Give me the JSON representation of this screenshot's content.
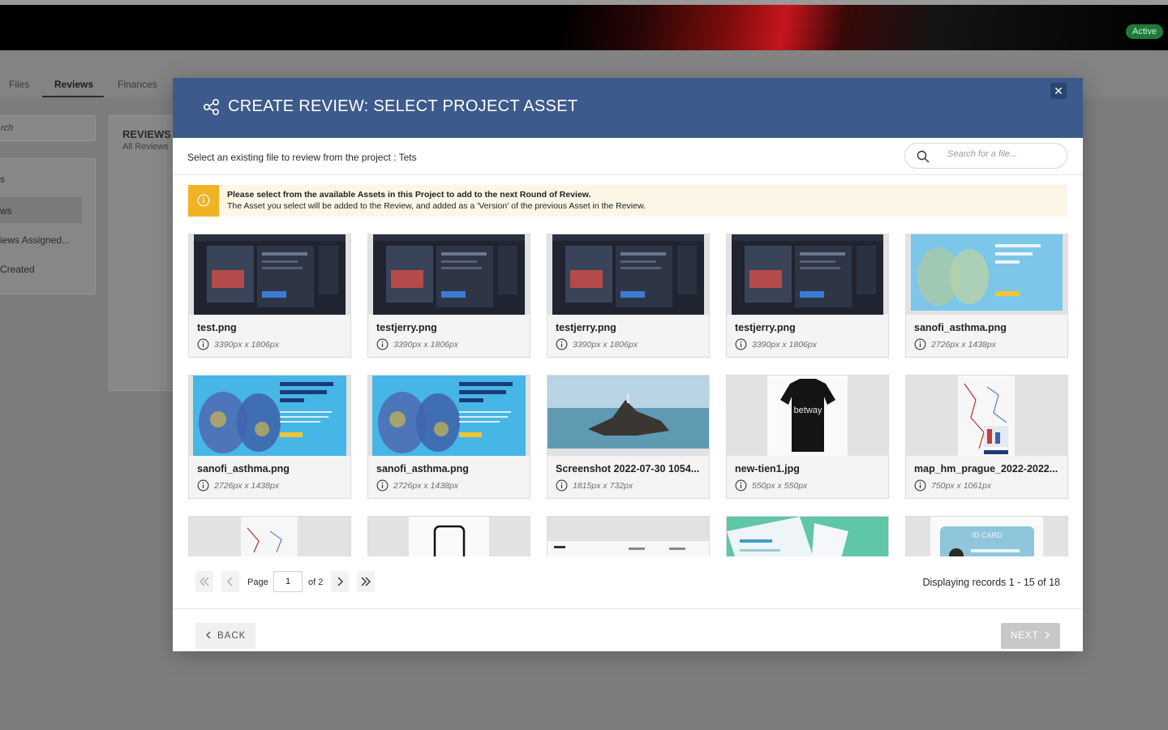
{
  "app": {
    "status_badge": "Active",
    "tabs": [
      {
        "label": "Files"
      },
      {
        "label": "Reviews"
      },
      {
        "label": "Finances"
      }
    ],
    "search_placeholder": "rch",
    "sidebar": {
      "items": [
        {
          "label": "s"
        },
        {
          "label": "ws"
        },
        {
          "label": "iews Assigned..."
        },
        {
          "label": "Created"
        }
      ]
    },
    "reviews_title": "REVIEWS",
    "reviews_subtitle": "All Reviews"
  },
  "modal": {
    "title": "CREATE REVIEW: SELECT PROJECT ASSET",
    "subheader": "Select an existing file to review from the project : Tets",
    "search_placeholder": "Search for a file...",
    "notice": {
      "line1": "Please select from the available Assets in this Project to add to the next Round of Review.",
      "line2": "The Asset you select will be added to the Review, and added as a 'Version' of the previous Asset in the Review."
    },
    "assets": [
      {
        "name": "test.png",
        "dims": "3390px x 1806px",
        "thumb": "screenshot-dark"
      },
      {
        "name": "testjerry.png",
        "dims": "3390px x 1806px",
        "thumb": "screenshot-dark"
      },
      {
        "name": "testjerry.png",
        "dims": "3390px x 1806px",
        "thumb": "screenshot-dark"
      },
      {
        "name": "testjerry.png",
        "dims": "3390px x 1806px",
        "thumb": "screenshot-dark"
      },
      {
        "name": "sanofi_asthma.png",
        "dims": "2726px x 1438px",
        "thumb": "lungs-light"
      },
      {
        "name": "sanofi_asthma.png",
        "dims": "2726px x 1438px",
        "thumb": "lungs"
      },
      {
        "name": "sanofi_asthma.png",
        "dims": "2726px x 1438px",
        "thumb": "lungs"
      },
      {
        "name": "Screenshot 2022-07-30 1054...",
        "dims": "1815px x 732px",
        "thumb": "island"
      },
      {
        "name": "new-tien1.jpg",
        "dims": "550px x 550px",
        "thumb": "jersey"
      },
      {
        "name": "map_hm_prague_2022-2022...",
        "dims": "750px x 1061px",
        "thumb": "map"
      },
      {
        "name": "",
        "dims": "",
        "thumb": "map-small"
      },
      {
        "name": "",
        "dims": "",
        "thumb": "phone"
      },
      {
        "name": "",
        "dims": "",
        "thumb": "webpage"
      },
      {
        "name": "",
        "dims": "",
        "thumb": "teal-card"
      },
      {
        "name": "",
        "dims": "",
        "thumb": "id-card"
      }
    ],
    "pagination": {
      "page_label": "Page",
      "current_page": "1",
      "of_label": "of 2",
      "records": "Displaying records 1 - 15 of 18"
    },
    "footer": {
      "back_label": "BACK",
      "next_label": "NEXT"
    }
  }
}
